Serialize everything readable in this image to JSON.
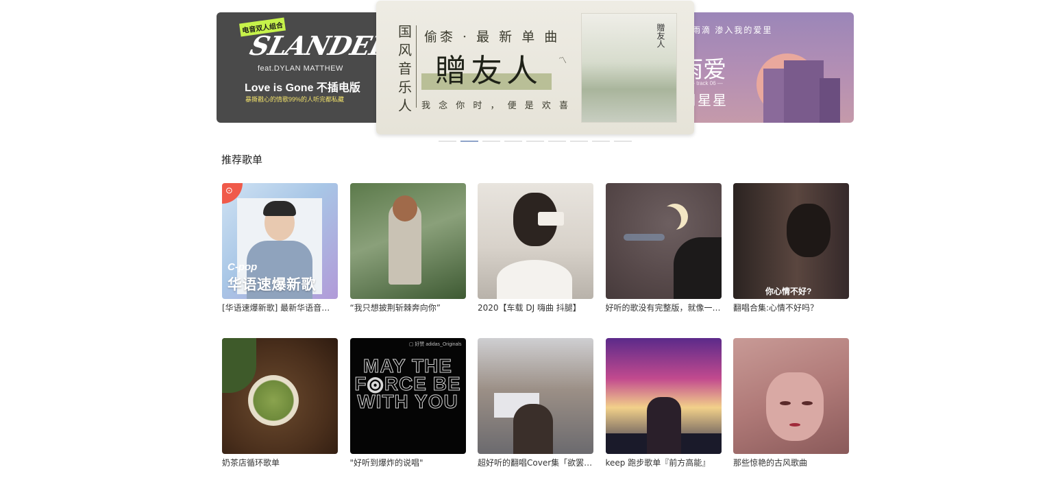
{
  "carousel": {
    "left": {
      "tag": "电音双人组合",
      "logo": "SLANDER",
      "feat": "feat.DYLAN MATTHEW",
      "title": "Love is Gone 不插电版",
      "subtitle": "暴撕戳心的情歌99%的人听完都私藏"
    },
    "center": {
      "left_column": "国风音乐人",
      "top": "偷桼 · 最 新 单 曲",
      "main": "贈友人",
      "bottom": "我 念 你 时 ， 便 是 欢 喜",
      "album_title": "贈友人"
    },
    "right": {
      "top": "像雨滴  渗入我的爱里",
      "main": "雨爱",
      "track": "— track 06 —",
      "artist": "周星星"
    },
    "dots": {
      "count": 9,
      "active_index": 1
    }
  },
  "section": {
    "title": "推荐歌单"
  },
  "playlists": [
    {
      "title": "[华语速爆新歌] 最新华语音乐推荐",
      "cover_text_1": "C-pop",
      "cover_text_2": "华语速爆新歌",
      "badge": "⊙"
    },
    {
      "title": "“我只想披荆斩棘奔向你”"
    },
    {
      "title": "2020【车载 DJ 嗨曲 抖腿】"
    },
    {
      "title": "好听的歌没有完整版，就像一场梦"
    },
    {
      "title": "翻唱合集:心情不好吗？",
      "cover_text": "你心情不好?"
    },
    {
      "title": "奶茶店循环歌单"
    },
    {
      "title": "\"好听到爆炸的说唱\"",
      "cover_text": "MAY THE F◎RCE BE WITH YOU",
      "cover_tag": "▢ 好赞  adidas_Originals"
    },
    {
      "title": "超好听的翻唱Cover集「欲罢不能」"
    },
    {
      "title": "keep 跑步歌单『前方高能』"
    },
    {
      "title": "那些惊艳的古风歌曲"
    }
  ],
  "colors": {
    "accent_dot": "#8ea3c9",
    "badge_red": "#f05a4a",
    "text_primary": "#333333"
  }
}
